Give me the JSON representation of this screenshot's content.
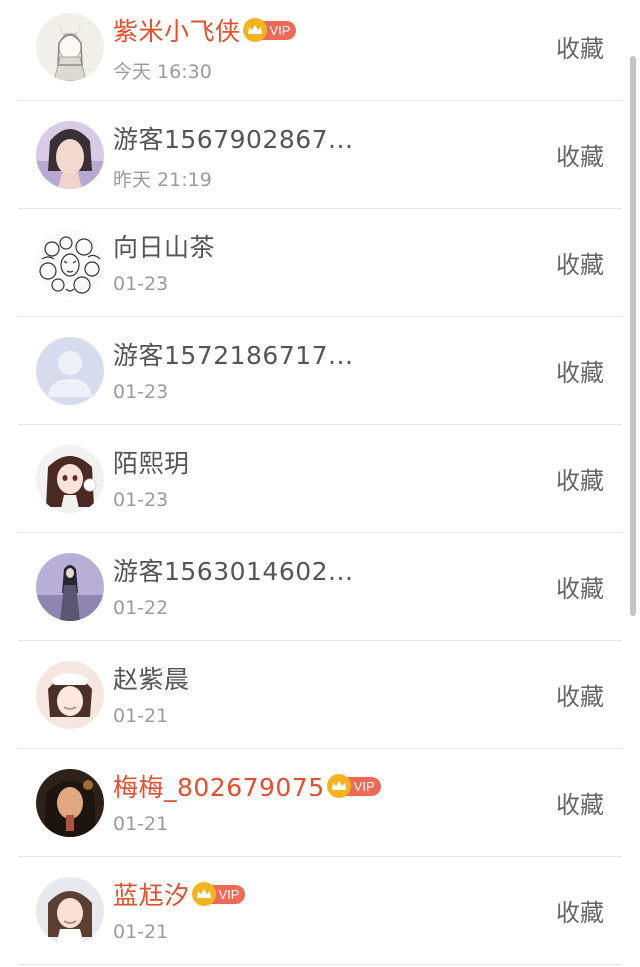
{
  "action_label": "收藏",
  "vip_label": "VIP",
  "rows": [
    {
      "name": "紫米小飞侠",
      "vip": true,
      "time": "今天 16:30"
    },
    {
      "name": "游客1567902867...",
      "vip": false,
      "time": "昨天 21:19"
    },
    {
      "name": "向日山茶",
      "vip": false,
      "time": "01-23"
    },
    {
      "name": "游客1572186717...",
      "vip": false,
      "time": "01-23"
    },
    {
      "name": "陌熙玥",
      "vip": false,
      "time": "01-23"
    },
    {
      "name": "游客1563014602...",
      "vip": false,
      "time": "01-22"
    },
    {
      "name": "赵紫晨",
      "vip": false,
      "time": "01-21"
    },
    {
      "name": "梅梅_802679075",
      "vip": true,
      "time": "01-21"
    },
    {
      "name": "蓝尪汐",
      "vip": true,
      "time": "01-21"
    }
  ],
  "colors": {
    "vip_name": "#e2502f",
    "crown": "#f5b41f",
    "vip_pill": "#ee6a57"
  }
}
